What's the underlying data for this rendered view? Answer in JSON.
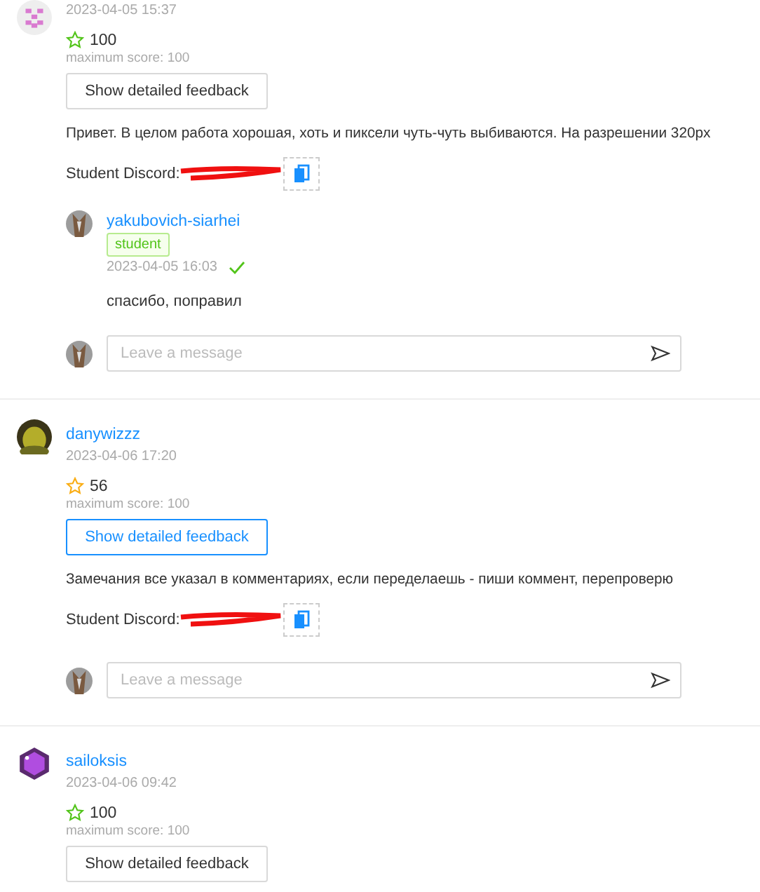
{
  "reviews": [
    {
      "avatar": {
        "kind": "pixel"
      },
      "date": "2023-04-05 15:37",
      "score": "100",
      "star": {
        "color": "#52c41a"
      },
      "max_score": "maximum score: 100",
      "feedback_button": {
        "label": "Show detailed feedback",
        "highlighted": false
      },
      "comment": "Привет. В целом работа хорошая, хоть и пиксели чуть-чуть выбиваются. На разрешении 320px",
      "discord_label": "Student Discord:",
      "replies": [
        {
          "author": "yakubovich-siarhei",
          "tag": "student",
          "date": "2023-04-05 16:03",
          "seen": true,
          "text": "спасибо,  поправил"
        }
      ],
      "message_placeholder": "Leave a message"
    },
    {
      "avatar": {
        "kind": "photo"
      },
      "author": "danywizzz",
      "date": "2023-04-06 17:20",
      "score": "56",
      "star": {
        "color": "#faad14"
      },
      "max_score": "maximum score: 100",
      "feedback_button": {
        "label": "Show detailed feedback",
        "highlighted": true
      },
      "comment": "Замечания все указал в комментариях, если переделаешь - пиши коммент, перепроверю",
      "discord_label": "Student Discord:",
      "message_placeholder": "Leave a message"
    },
    {
      "avatar": {
        "kind": "gem"
      },
      "author": "sailoksis",
      "date": "2023-04-06 09:42",
      "score": "100",
      "star": {
        "color": "#52c41a"
      },
      "max_score": "maximum score: 100",
      "feedback_button": {
        "label": "Show detailed feedback",
        "highlighted": false
      }
    }
  ]
}
